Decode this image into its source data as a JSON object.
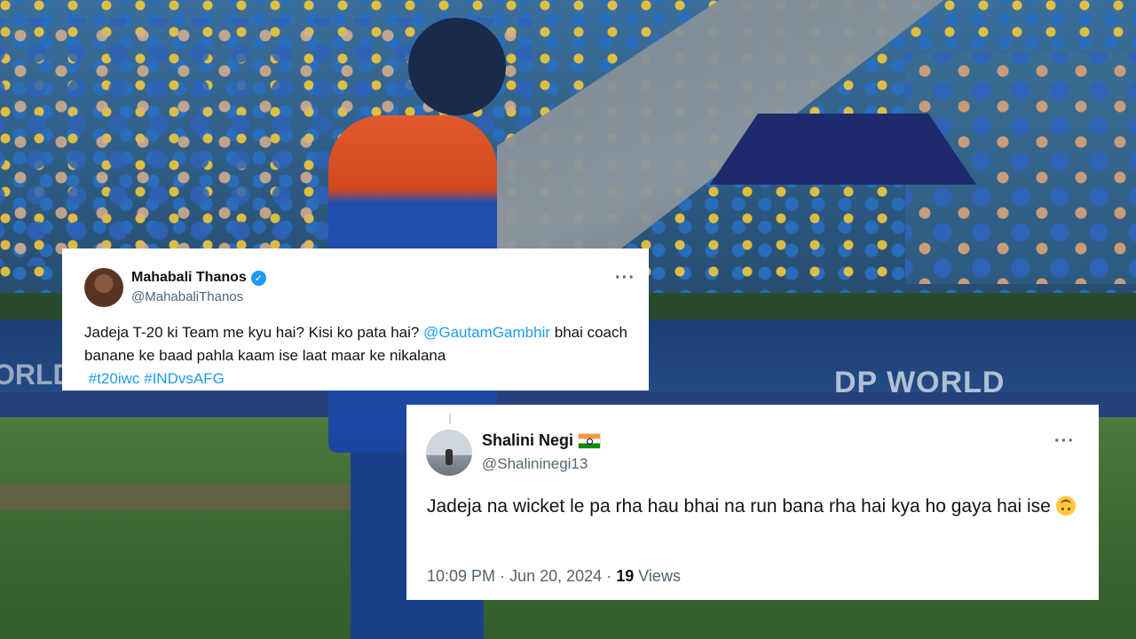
{
  "background": {
    "board_text": "DP WORLD",
    "board_text_left": "ORLD"
  },
  "tweets": [
    {
      "display_name": "Mahabali Thanos",
      "handle": "@MahabaliThanos",
      "verified": true,
      "text_part1": "Jadeja T-20 ki Team me kyu hai? Kisi ko pata hai? ",
      "mention": "@GautamGambhir",
      "text_part2": " bhai coach banane ke baad pahla kaam ise laat maar ke nikalana",
      "hashtag1": "#t20iwc",
      "hashtag2": "#INDvsAFG",
      "more_icon": "more-horizontal-icon"
    },
    {
      "display_name": "Shalini Negi",
      "handle": "@Shalininegi13",
      "flag_icon": "india-flag-icon",
      "text": "Jadeja na wicket le pa rha hau bhai na run bana rha hai kya ho gaya hai ise",
      "emoji_icon": "upside-down-face-icon",
      "time": "10:09 PM",
      "separator": "·",
      "date": "Jun 20, 2024",
      "views_count": "19",
      "views_label": "Views",
      "more_icon": "more-horizontal-icon"
    }
  ],
  "colors": {
    "link": "#1d9bf0",
    "verified": "#1d9bf0",
    "text_primary": "#0f1419",
    "text_secondary": "#536471"
  }
}
